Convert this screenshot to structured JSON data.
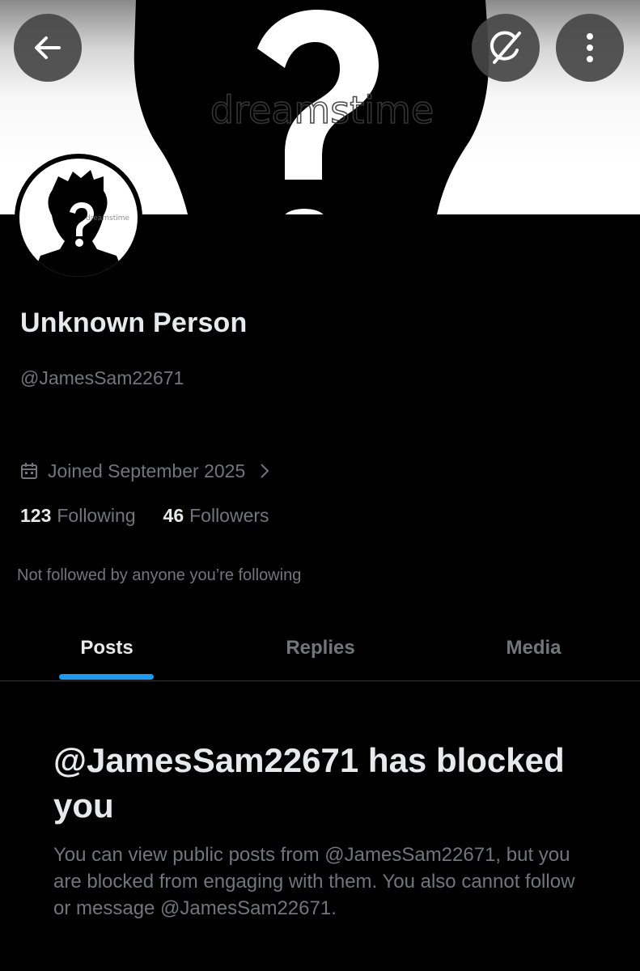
{
  "banner": {
    "watermark": "dreamstime"
  },
  "nav": {
    "back_icon": "back-arrow-icon",
    "grok_icon": "grok-icon",
    "more_icon": "more-vertical-icon"
  },
  "avatar": {
    "watermark": "dreamstime"
  },
  "profile": {
    "name": "Unknown Person",
    "handle": "@JamesSam22671",
    "joined": "Joined September 2025",
    "following_count": "123",
    "following_label": "Following",
    "followers_count": "46",
    "followers_label": "Followers",
    "not_followed": "Not followed by anyone you’re following"
  },
  "tabs": [
    {
      "label": "Posts",
      "active": true
    },
    {
      "label": "Replies",
      "active": false
    },
    {
      "label": "Media",
      "active": false
    }
  ],
  "blocked": {
    "title": "@JamesSam22671 has blocked you",
    "body": "You can view public posts from @JamesSam22671, but you are blocked from engaging with them. You also cannot follow or message @JamesSam22671."
  },
  "colors": {
    "background": "#000000",
    "primary_text": "#e7e9ea",
    "secondary_text": "#71767b",
    "accent": "#1d9bf0",
    "divider": "#2f3336"
  }
}
